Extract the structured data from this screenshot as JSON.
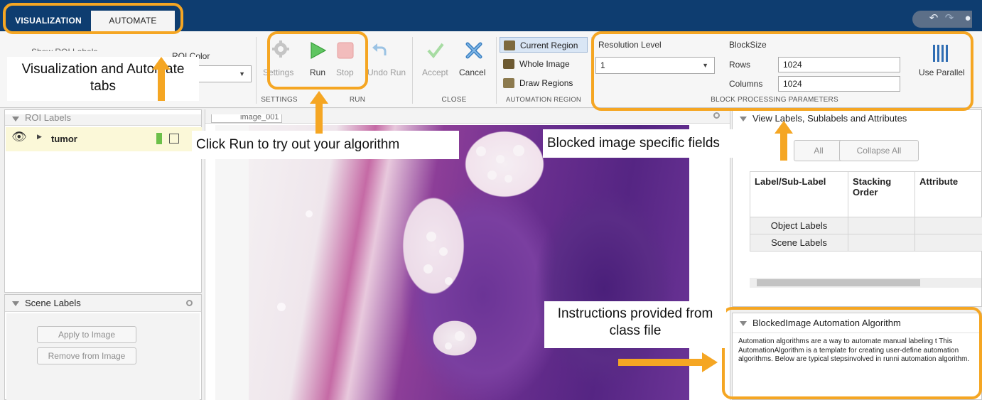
{
  "tabs": {
    "visualization": "VISUALIZATION",
    "automate": "AUTOMATE"
  },
  "toolstrip": {
    "show_roi_labels": "Show ROI Labels",
    "roi_color": "ROI Color",
    "settings": "Settings",
    "run": "Run",
    "stop": "Stop",
    "undo_run": "Undo Run",
    "accept": "Accept",
    "cancel": "Cancel",
    "current_region": "Current Region",
    "whole_image": "Whole Image",
    "draw_regions": "Draw Regions",
    "resolution_level_label": "Resolution Level",
    "resolution_level_value": "1",
    "blocksize_label": "BlockSize",
    "rows_label": "Rows",
    "rows_value": "1024",
    "columns_label": "Columns",
    "columns_value": "1024",
    "use_parallel": "Use Parallel",
    "groups": {
      "settings": "SETTINGS",
      "run": "RUN",
      "close": "CLOSE",
      "automation_region": "AUTOMATION REGION",
      "block_processing": "BLOCK PROCESSING PARAMETERS"
    }
  },
  "left_panel": {
    "roi_labels_title": "ROI Labels",
    "roi_item": "tumor",
    "roi_color": "#6cc04a",
    "scene_labels_title": "Scene Labels",
    "apply_to_image": "Apply to Image",
    "remove_from_image": "Remove from Image"
  },
  "center": {
    "image_tab": "image_001"
  },
  "right_panel": {
    "view_title": "View Labels, Sublabels and Attributes",
    "expand_all": "All",
    "collapse_all": "Collapse All",
    "table_headers": [
      "Label/Sub-Label",
      "Stacking Order",
      "Attribute"
    ],
    "table_rows": [
      "Object Labels",
      "Scene Labels"
    ],
    "algo_title": "BlockedImage Automation Algorithm",
    "algo_text": "Automation algorithms are a way to automate manual labeling t This AutomationAlgorithm is a template for creating user-define automation algorithms. Below are typical stepsinvolved in runni automation algorithm."
  },
  "callouts": {
    "tabs": "Visualization and Automate tabs",
    "run": "Click Run to try out your algorithm",
    "blocked": "Blocked image specific fields",
    "instructions": "Instructions provided from class file"
  },
  "colors": {
    "accent": "#f5a623",
    "titlebar": "#0e3d70"
  }
}
